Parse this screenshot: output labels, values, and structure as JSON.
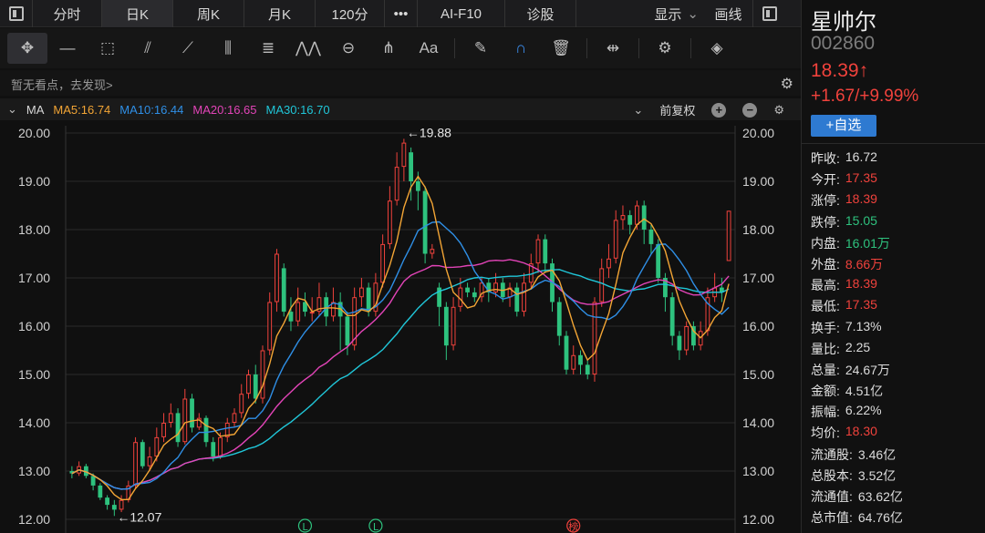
{
  "tabs": [
    {
      "label": "分时",
      "active": false
    },
    {
      "label": "日K",
      "active": true
    },
    {
      "label": "周K",
      "active": false
    },
    {
      "label": "月K",
      "active": false
    },
    {
      "label": "120分",
      "active": false
    },
    {
      "label": "•••",
      "active": false
    },
    {
      "label": "AI-F10",
      "active": false
    },
    {
      "label": "诊股",
      "active": false
    },
    {
      "label": "显示",
      "active": false
    },
    {
      "label": "画线",
      "active": false
    }
  ],
  "notes": {
    "text": "暂无看点，去发现>"
  },
  "ma": {
    "label": "MA",
    "ma5": "MA5:16.74",
    "ma10": "MA10:16.44",
    "ma20": "MA20:16.65",
    "ma30": "MA30:16.70",
    "adjust": "前复权",
    "colors": {
      "ma5": "#f3a535",
      "ma10": "#2f8fe6",
      "ma20": "#e344b8",
      "ma30": "#20c6d8"
    }
  },
  "stock": {
    "name": "星帅尔",
    "code": "002860",
    "price": "18.39",
    "arrow": "↑",
    "change": "+1.67/+9.99%",
    "add_button": "+自选"
  },
  "stats": [
    {
      "label": "昨收:",
      "value": "16.72",
      "color": "white"
    },
    {
      "label": "今开:",
      "value": "17.35",
      "color": "red"
    },
    {
      "label": "涨停:",
      "value": "18.39",
      "color": "red"
    },
    {
      "label": "跌停:",
      "value": "15.05",
      "color": "green"
    },
    {
      "label": "内盘:",
      "value": "16.01万",
      "color": "green"
    },
    {
      "label": "外盘:",
      "value": "8.66万",
      "color": "red"
    },
    {
      "label": "最高:",
      "value": "18.39",
      "color": "red"
    },
    {
      "label": "最低:",
      "value": "17.35",
      "color": "red"
    },
    {
      "label": "换手:",
      "value": "7.13%",
      "color": "white"
    },
    {
      "label": "量比:",
      "value": "2.25",
      "color": "white"
    },
    {
      "label": "总量:",
      "value": "24.67万",
      "color": "white"
    },
    {
      "label": "金额:",
      "value": "4.51亿",
      "color": "white"
    },
    {
      "label": "振幅:",
      "value": "6.22%",
      "color": "white"
    },
    {
      "label": "均价:",
      "value": "18.30",
      "color": "red"
    },
    {
      "label": "流通股:",
      "value": "3.46亿",
      "color": "white"
    },
    {
      "label": "总股本:",
      "value": "3.52亿",
      "color": "white"
    },
    {
      "label": "流通值:",
      "value": "63.62亿",
      "color": "white"
    },
    {
      "label": "总市值:",
      "value": "64.76亿",
      "color": "white"
    }
  ],
  "colors": {
    "up": "#f0423c",
    "down": "#2ec27e",
    "grid": "#2a2a2a"
  },
  "chart_data": {
    "type": "candlestick",
    "ylim": [
      12.0,
      20.0
    ],
    "yticks": [
      "20.00",
      "19.00",
      "18.00",
      "17.00",
      "16.00",
      "15.00",
      "14.00",
      "13.00",
      "12.00"
    ],
    "annotations": [
      {
        "text": "←19.88",
        "value": 19.88
      },
      {
        "text": "←12.07",
        "value": 12.07
      }
    ],
    "markers": [
      "L",
      "L",
      "榜"
    ],
    "candles": [
      [
        13.0,
        12.95,
        13.1,
        12.85
      ],
      [
        12.95,
        13.1,
        13.2,
        12.9
      ],
      [
        13.1,
        12.9,
        13.15,
        12.85
      ],
      [
        12.9,
        12.7,
        12.95,
        12.6
      ],
      [
        12.7,
        12.45,
        12.75,
        12.4
      ],
      [
        12.45,
        12.3,
        12.5,
        12.2
      ],
      [
        12.3,
        12.2,
        12.4,
        12.07
      ],
      [
        12.2,
        12.4,
        12.5,
        12.15
      ],
      [
        12.4,
        12.7,
        12.8,
        12.35
      ],
      [
        12.7,
        13.6,
        13.7,
        12.65
      ],
      [
        13.6,
        13.1,
        13.65,
        13.05
      ],
      [
        13.1,
        13.3,
        13.5,
        13.0
      ],
      [
        13.3,
        13.7,
        13.9,
        13.2
      ],
      [
        13.7,
        14.0,
        14.2,
        13.6
      ],
      [
        14.0,
        14.2,
        14.4,
        13.9
      ],
      [
        14.2,
        13.6,
        14.3,
        13.5
      ],
      [
        13.6,
        14.5,
        14.7,
        13.55
      ],
      [
        14.5,
        13.9,
        14.6,
        13.8
      ],
      [
        13.9,
        14.1,
        14.2,
        13.85
      ],
      [
        14.1,
        13.6,
        14.15,
        13.5
      ],
      [
        13.6,
        13.3,
        13.7,
        13.2
      ],
      [
        13.3,
        13.7,
        13.8,
        13.25
      ],
      [
        13.7,
        14.0,
        14.1,
        13.6
      ],
      [
        14.0,
        14.2,
        14.3,
        13.9
      ],
      [
        14.2,
        14.6,
        14.8,
        14.1
      ],
      [
        14.6,
        15.0,
        15.1,
        14.5
      ],
      [
        15.0,
        14.5,
        15.2,
        14.4
      ],
      [
        14.5,
        15.5,
        15.6,
        14.4
      ],
      [
        15.5,
        16.5,
        16.7,
        15.4
      ],
      [
        16.5,
        17.5,
        17.6,
        16.3
      ],
      [
        17.2,
        16.3,
        17.3,
        16.2
      ],
      [
        16.3,
        16.1,
        16.6,
        15.9
      ],
      [
        16.1,
        16.5,
        16.8,
        16.0
      ],
      [
        16.5,
        16.3,
        16.7,
        16.2
      ],
      [
        16.3,
        16.3,
        16.6,
        16.1
      ],
      [
        16.3,
        16.6,
        16.9,
        16.2
      ],
      [
        16.6,
        16.2,
        16.7,
        16.0
      ],
      [
        16.2,
        16.5,
        16.8,
        16.1
      ],
      [
        16.5,
        16.2,
        16.7,
        15.5
      ],
      [
        16.2,
        15.6,
        16.3,
        15.4
      ],
      [
        15.6,
        16.6,
        16.8,
        15.5
      ],
      [
        16.6,
        16.8,
        17.0,
        16.4
      ],
      [
        16.8,
        16.3,
        16.9,
        16.2
      ],
      [
        16.3,
        16.9,
        17.1,
        16.2
      ],
      [
        16.9,
        17.7,
        17.9,
        16.8
      ],
      [
        17.7,
        18.6,
        18.9,
        17.6
      ],
      [
        18.6,
        19.3,
        19.6,
        18.5
      ],
      [
        19.3,
        19.8,
        19.88,
        19.0
      ],
      [
        19.6,
        19.0,
        19.7,
        18.6
      ],
      [
        19.0,
        18.8,
        19.2,
        18.4
      ],
      [
        18.8,
        17.5,
        18.9,
        17.3
      ],
      [
        17.5,
        17.6,
        17.7,
        17.4
      ],
      [
        16.8,
        16.4,
        16.9,
        16.0
      ],
      [
        16.4,
        15.6,
        16.5,
        15.3
      ],
      [
        15.6,
        16.4,
        16.6,
        15.5
      ],
      [
        16.4,
        16.8,
        17.0,
        16.3
      ],
      [
        16.8,
        16.7,
        16.9,
        16.6
      ],
      [
        16.7,
        16.6,
        16.8,
        16.5
      ],
      [
        16.6,
        16.9,
        17.0,
        16.5
      ],
      [
        16.9,
        16.7,
        17.0,
        16.5
      ],
      [
        16.7,
        16.9,
        17.1,
        16.6
      ],
      [
        16.9,
        16.6,
        17.0,
        16.5
      ],
      [
        16.6,
        16.8,
        16.9,
        16.4
      ],
      [
        16.8,
        16.3,
        16.9,
        16.2
      ],
      [
        16.3,
        16.9,
        17.1,
        16.2
      ],
      [
        16.9,
        17.3,
        17.5,
        16.8
      ],
      [
        17.3,
        17.8,
        17.9,
        17.1
      ],
      [
        17.8,
        17.3,
        17.9,
        17.1
      ],
      [
        17.3,
        16.5,
        17.4,
        16.3
      ],
      [
        16.5,
        15.8,
        16.6,
        15.6
      ],
      [
        15.8,
        15.1,
        15.9,
        15.0
      ],
      [
        15.1,
        15.4,
        15.6,
        15.0
      ],
      [
        15.4,
        15.2,
        15.5,
        15.0
      ],
      [
        15.2,
        15.0,
        15.3,
        14.9
      ],
      [
        15.0,
        16.5,
        16.6,
        14.85
      ],
      [
        16.5,
        17.2,
        17.4,
        16.4
      ],
      [
        17.2,
        17.4,
        17.7,
        17.0
      ],
      [
        17.4,
        18.2,
        18.4,
        17.3
      ],
      [
        18.2,
        18.3,
        18.5,
        18.0
      ],
      [
        18.3,
        18.1,
        18.4,
        17.9
      ],
      [
        18.1,
        18.5,
        18.6,
        18.0
      ],
      [
        18.5,
        18.0,
        18.6,
        17.7
      ],
      [
        18.0,
        17.7,
        18.1,
        17.5
      ],
      [
        17.7,
        17.0,
        17.8,
        16.9
      ],
      [
        17.0,
        16.6,
        17.1,
        16.3
      ],
      [
        16.6,
        15.8,
        16.7,
        15.6
      ],
      [
        15.8,
        15.5,
        15.9,
        15.3
      ],
      [
        15.5,
        16.0,
        16.1,
        15.4
      ],
      [
        16.0,
        15.6,
        16.1,
        15.5
      ],
      [
        15.6,
        15.9,
        16.1,
        15.5
      ],
      [
        15.9,
        16.6,
        16.8,
        15.8
      ],
      [
        16.6,
        16.8,
        17.1,
        16.5
      ],
      [
        16.8,
        16.7,
        17.0,
        16.5
      ],
      [
        17.35,
        18.39,
        18.39,
        17.35
      ]
    ]
  }
}
